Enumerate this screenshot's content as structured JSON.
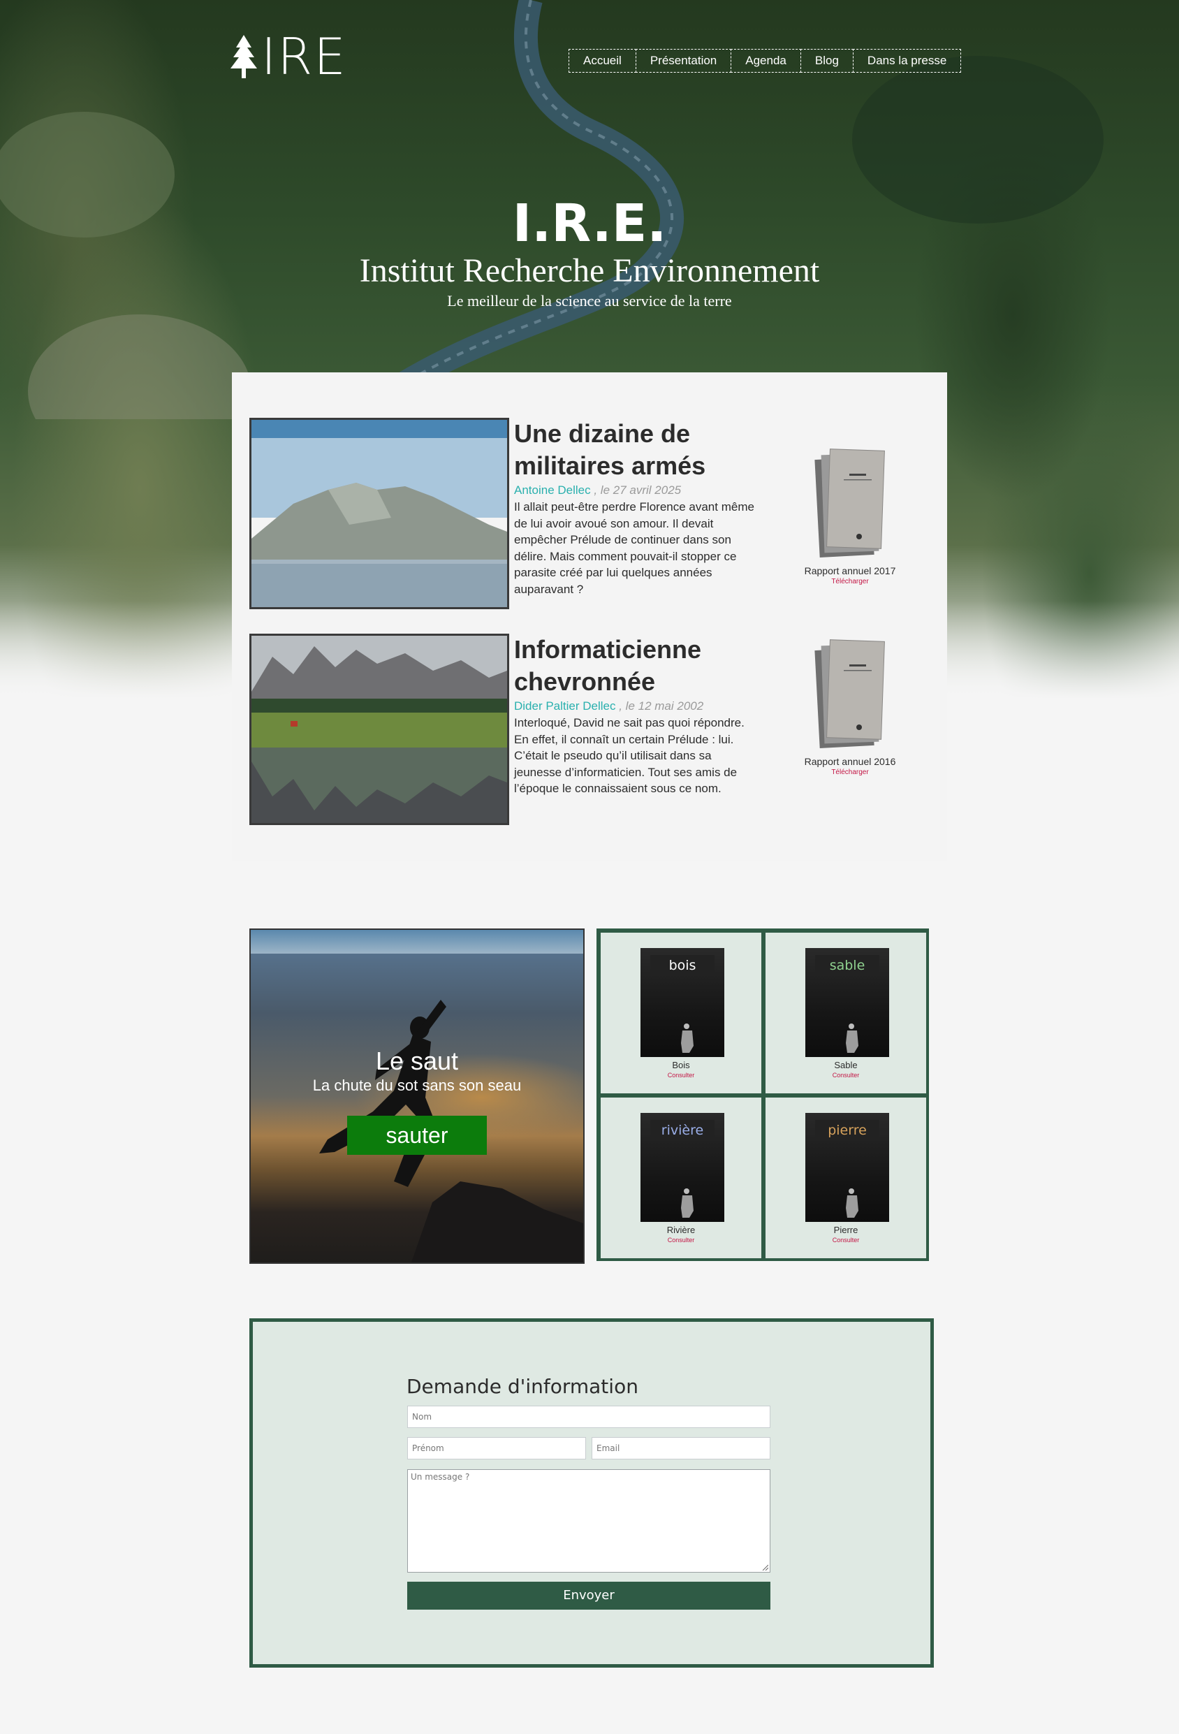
{
  "header": {
    "logo_text": "IRE",
    "nav": [
      "Accueil",
      "Présentation",
      "Agenda",
      "Blog",
      "Dans la presse"
    ]
  },
  "hero": {
    "abbr": "I.R.E.",
    "title": "Institut Recherche Environnement",
    "tagline": "Le meilleur de la science au service de la terre"
  },
  "articles": [
    {
      "title": "Une dizaine de militaires armés",
      "author": "Antoine Dellec",
      "date": ", le 27 avril 2025",
      "body": "Il allait peut-être perdre Florence avant même de lui avoir avoué son amour. Il devait empêcher Prélude de continuer dans son délire. Mais comment pouvait-il stopper ce parasite créé par lui quelques années auparavant ?"
    },
    {
      "title": "Informaticienne chevronnée",
      "author": "Dider Paltier Dellec",
      "date": ", le 12 mai 2002",
      "body": "Interloqué, David ne sait pas quoi répondre. En effet, il connaît un certain Prélude : lui. C’était le pseudo qu’il utilisait dans sa jeunesse d’informaticien. Tout ses amis de l’époque le connaissaient sous ce nom."
    }
  ],
  "reports": [
    {
      "label": "Rapport annuel 2017",
      "link": "Télécharger"
    },
    {
      "label": "Rapport annuel 2016",
      "link": "Télécharger"
    }
  ],
  "jump": {
    "title": "Le saut",
    "subtitle": "La chute du sot sans son seau",
    "button": "sauter"
  },
  "books": [
    {
      "word": "bois",
      "label": "Bois",
      "link": "Consulter",
      "color": "#ffffff"
    },
    {
      "word": "sable",
      "label": "Sable",
      "link": "Consulter",
      "color": "#8fd18f"
    },
    {
      "word": "rivière",
      "label": "Rivière",
      "link": "Consulter",
      "color": "#9aaee8"
    },
    {
      "word": "pierre",
      "label": "Pierre",
      "link": "Consulter",
      "color": "#d6a25c"
    }
  ],
  "form": {
    "title": "Demande d'information",
    "name_placeholder": "Nom",
    "firstname_placeholder": "Prénom",
    "email_placeholder": "Email",
    "message_placeholder": "Un message ?",
    "submit": "Envoyer"
  },
  "colors": {
    "accent_green": "#2f5b45",
    "link_red": "#c31645",
    "author_teal": "#2ab0ae",
    "button_green": "#0c7c0c"
  }
}
